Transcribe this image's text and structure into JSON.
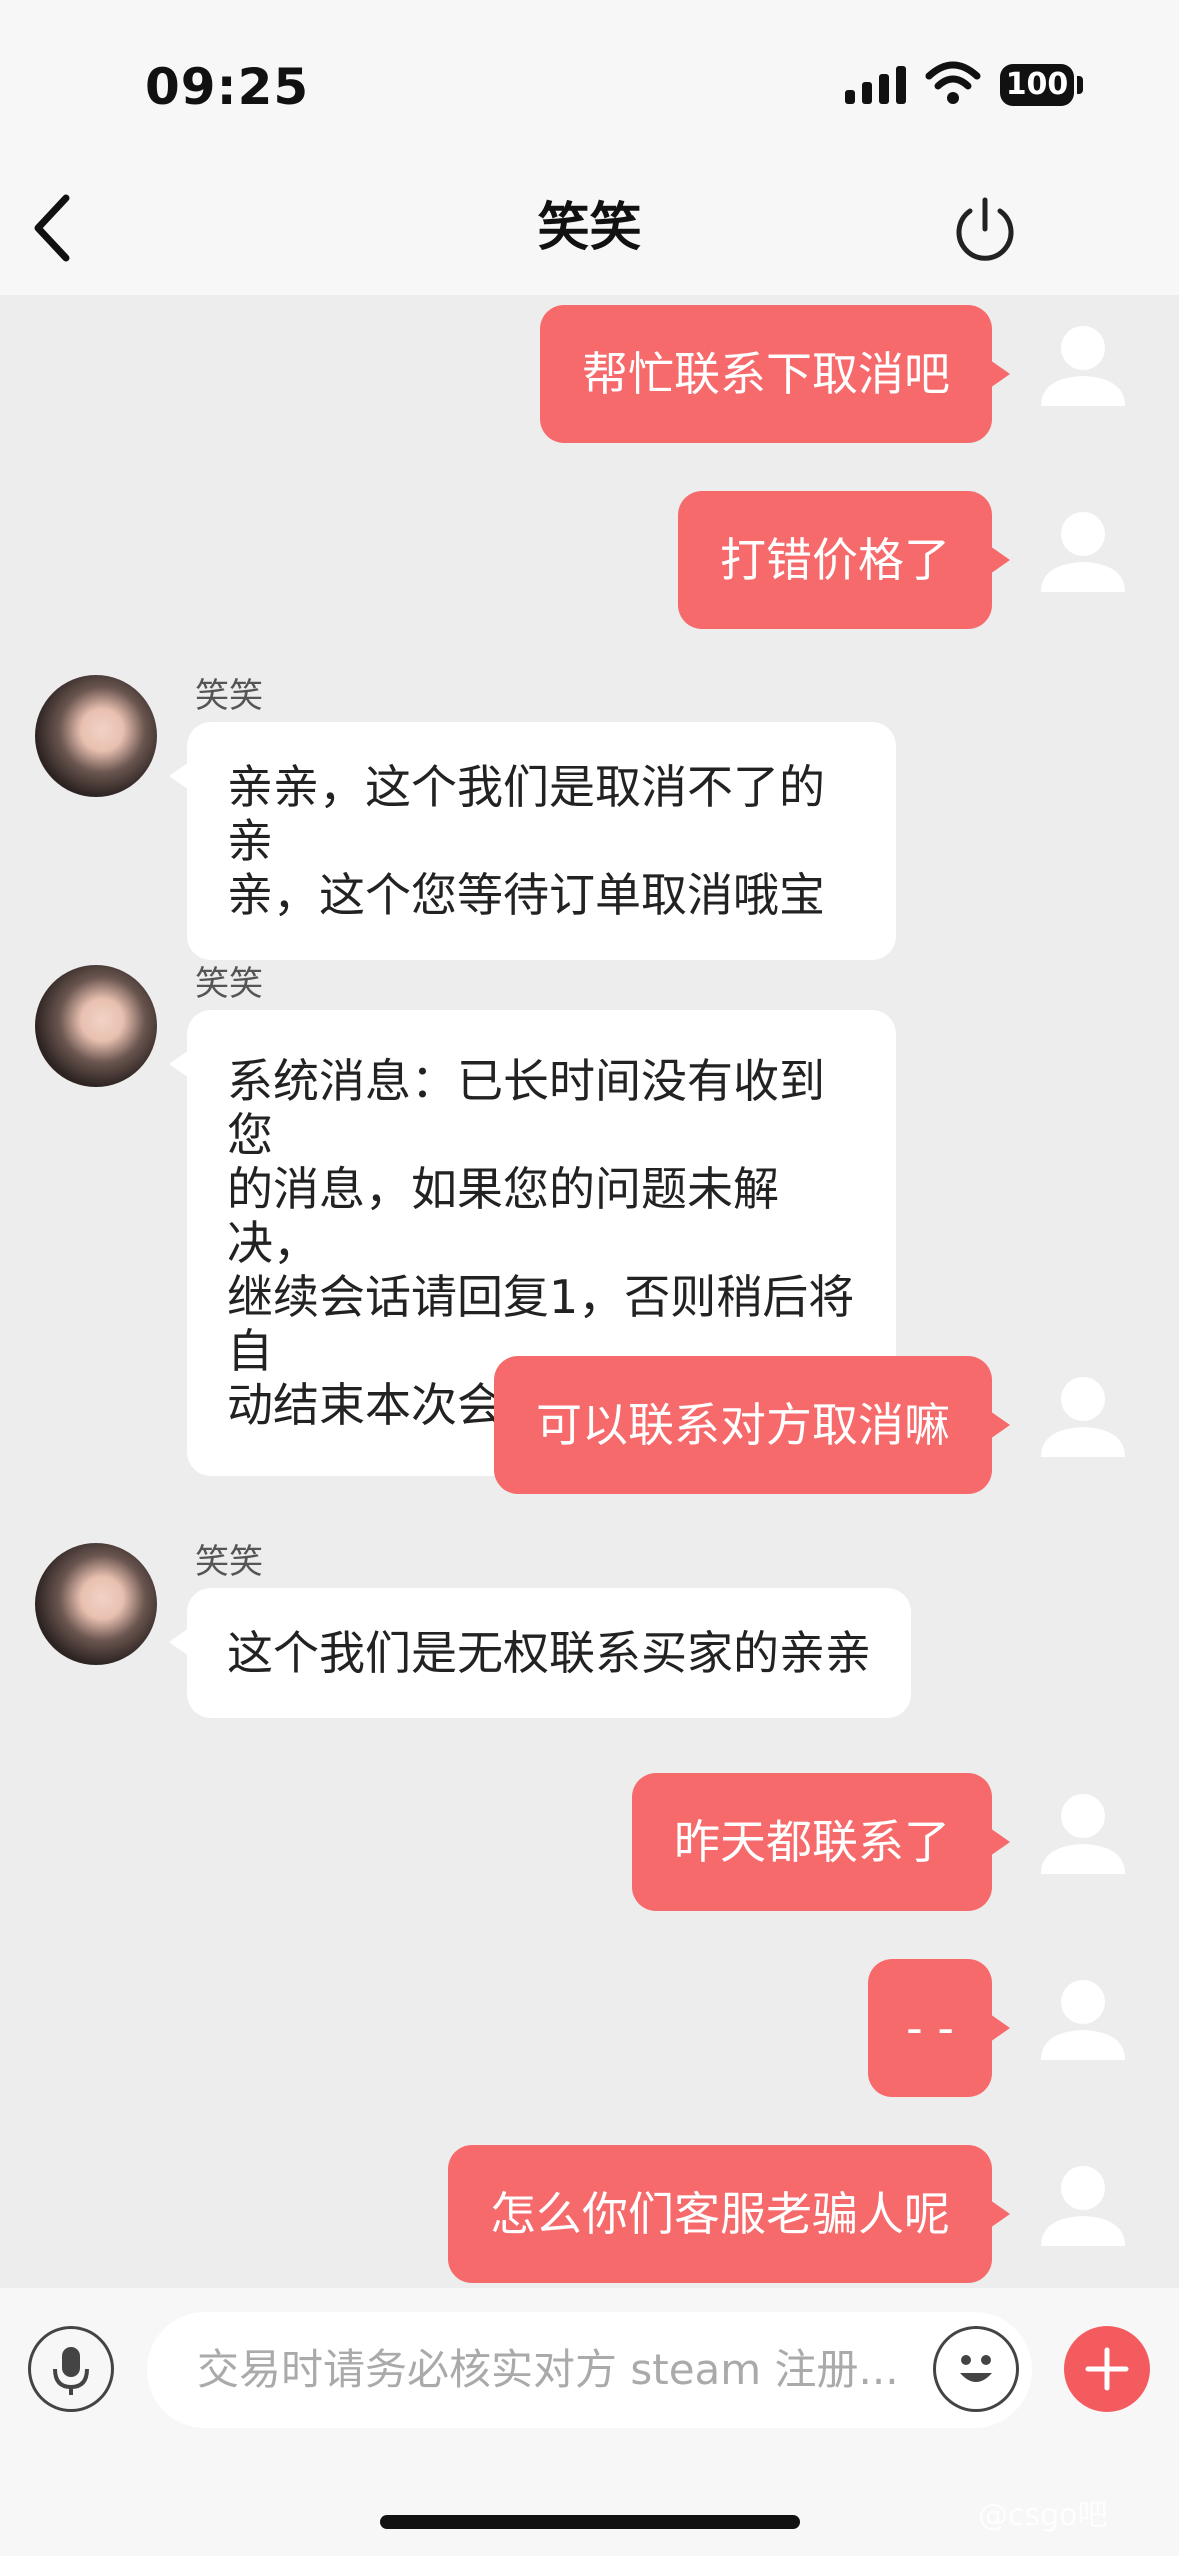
{
  "status_bar": {
    "time": "09:25",
    "battery": "100"
  },
  "header": {
    "title": "笑笑"
  },
  "messages": [
    {
      "side": "out",
      "text": "帮忙联系下取消吧"
    },
    {
      "side": "out",
      "text": "打错价格了"
    },
    {
      "side": "in",
      "name": "笑笑",
      "lines": [
        "亲亲，这个我们是取消不了的亲",
        "亲，这个您等待订单取消哦宝"
      ]
    },
    {
      "side": "in",
      "name": "笑笑",
      "lines": [
        "系统消息：已长时间没有收到您",
        "的消息，如果您的问题未解决，",
        "继续会话请回复1，否则稍后将自",
        "动结束本次会话。"
      ]
    },
    {
      "side": "out",
      "text": "可以联系对方取消嘛"
    },
    {
      "side": "in",
      "name": "笑笑",
      "lines": [
        "这个我们是无权联系买家的亲亲"
      ]
    },
    {
      "side": "out",
      "text": "昨天都联系了"
    },
    {
      "side": "out",
      "text": "- -"
    },
    {
      "side": "out",
      "text": "怎么你们客服老骗人呢"
    }
  ],
  "input": {
    "placeholder": "交易时请务必核实对方 steam 注册..."
  },
  "icons": {
    "back": "chevron-left-icon",
    "power": "power-icon",
    "mic": "microphone-icon",
    "emoji": "smiley-icon",
    "plus": "plus-icon",
    "user_avatar": "default-user-avatar-icon"
  },
  "colors": {
    "outgoing_bubble": "#f66a6b",
    "incoming_bubble": "#ffffff",
    "background": "#ededed",
    "plus_button": "#f45b5f"
  },
  "watermark": "@csgo吧"
}
